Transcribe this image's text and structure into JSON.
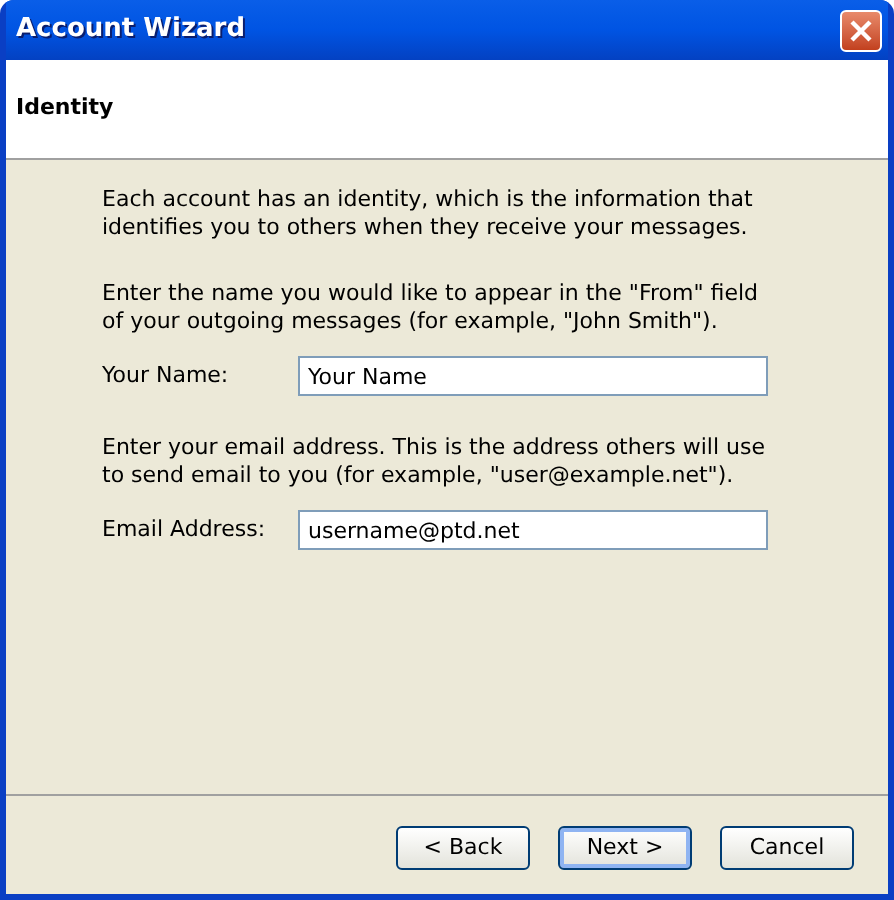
{
  "window": {
    "title": "Account Wizard"
  },
  "header": {
    "title": "Identity"
  },
  "intro": "Each account has an identity, which is the information that identifies you to others when they receive your messages.",
  "fields": [
    {
      "description": "Enter the name you would like to appear in the \"From\" field of your outgoing messages (for example, \"John Smith\").",
      "label": "Your Name:",
      "value": "Your Name"
    },
    {
      "description": "Enter your email address. This is the address others will use to send email to you (for example, \"user@example.net\").",
      "label": "Email Address:",
      "value": "username@ptd.net"
    }
  ],
  "buttons": [
    {
      "label": "< Back",
      "default": false
    },
    {
      "label": "Next >",
      "default": true
    },
    {
      "label": "Cancel",
      "default": false
    }
  ]
}
